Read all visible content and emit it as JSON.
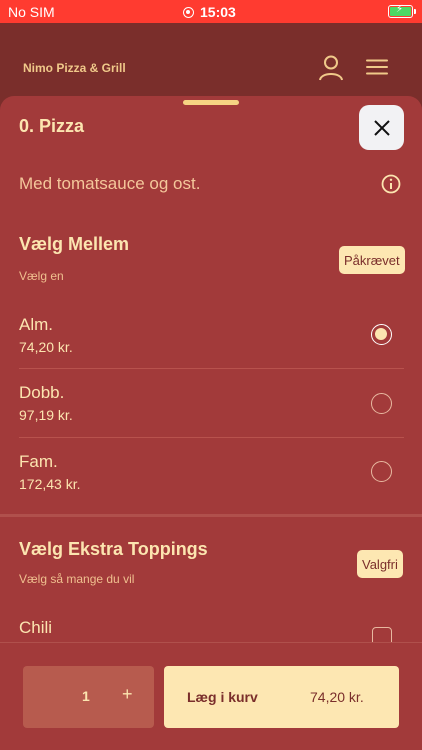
{
  "status_bar": {
    "carrier": "No SIM",
    "time": "15:03",
    "battery_icon": "battery-charging-icon",
    "accent": "#ff3b30"
  },
  "header": {
    "brand": "Nimo Pizza & Grill",
    "user_icon": "user-icon",
    "menu_icon": "hamburger-menu-icon"
  },
  "product": {
    "title": "0. Pizza",
    "description": "Med tomatsauce og ost.",
    "close_icon": "close-icon",
    "info_icon": "info-icon"
  },
  "groups": [
    {
      "title": "Vælg Mellem",
      "subtitle": "Vælg en",
      "tag": "Påkrævet",
      "options": [
        {
          "name": "Alm.",
          "price": "74,20 kr.",
          "selected": true
        },
        {
          "name": "Dobb.",
          "price": "97,19 kr.",
          "selected": false
        },
        {
          "name": "Fam.",
          "price": "172,43 kr.",
          "selected": false
        }
      ]
    },
    {
      "title": "Vælg Ekstra Toppings",
      "subtitle": "Vælg så mange du vil",
      "tag": "Valgfri",
      "options": [
        {
          "name": "Chili",
          "selected": false
        }
      ]
    }
  ],
  "cart": {
    "quantity": "1",
    "plus": "+",
    "add_label": "Læg i kurv",
    "total": "74,20 kr."
  },
  "colors": {
    "background": "#7a2e2b",
    "sheet": "#a23a3a",
    "accent": "#fde7b2",
    "text": "#fce5b0"
  }
}
